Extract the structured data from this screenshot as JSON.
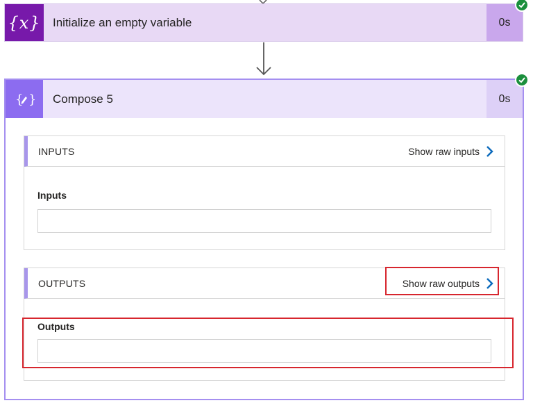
{
  "step1": {
    "icon_text": "{x}",
    "title": "Initialize an empty variable",
    "duration": "0s",
    "status": "succeeded"
  },
  "compose": {
    "title": "Compose 5",
    "duration": "0s",
    "status": "succeeded",
    "inputs_section": {
      "header": "INPUTS",
      "raw_link": "Show raw inputs",
      "field_label": "Inputs",
      "field_value": ""
    },
    "outputs_section": {
      "header": "OUTPUTS",
      "raw_link": "Show raw outputs",
      "field_label": "Outputs",
      "field_value": ""
    }
  },
  "colors": {
    "variable_icon_bg": "#7719aa",
    "compose_icon_bg": "#8c6cf0",
    "success": "#1a8f3c",
    "highlight": "#d7262e",
    "link_chevron": "#0f6cbd"
  }
}
